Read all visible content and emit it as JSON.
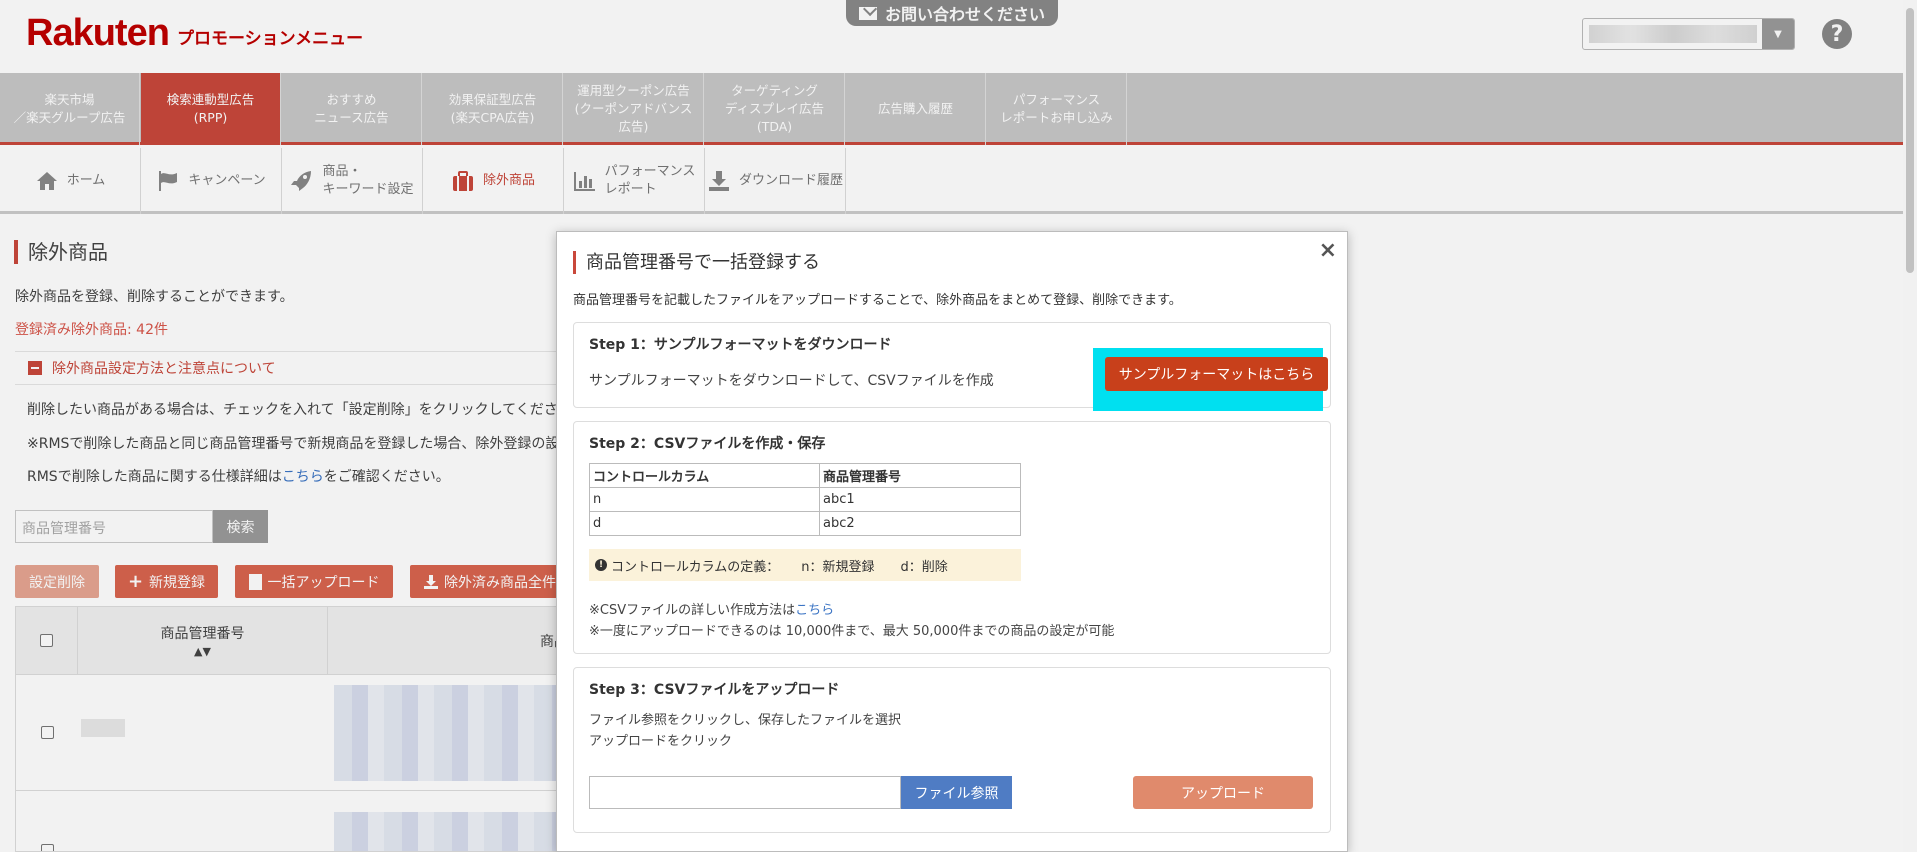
{
  "header": {
    "logo": "Rakuten",
    "logo_sub": "プロモーションメニュー",
    "contact": "お問い合わせください",
    "help": "?"
  },
  "main_nav": [
    {
      "label": "楽天市場\n／楽天グループ広告"
    },
    {
      "label": "検索連動型広告\n(RPP)"
    },
    {
      "label": "おすすめ\nニュース広告"
    },
    {
      "label": "効果保証型広告\n(楽天CPA広告)"
    },
    {
      "label": "運用型クーポン広告\n(クーポンアドバンス\n広告)"
    },
    {
      "label": "ターゲティング\nディスプレイ広告\n(TDA)"
    },
    {
      "label": "広告購入履歴"
    },
    {
      "label": "パフォーマンス\nレポートお申し込み"
    }
  ],
  "sub_nav": [
    {
      "label": "ホーム"
    },
    {
      "label": "キャンペーン"
    },
    {
      "label": "商品・\nキーワード設定"
    },
    {
      "label": "除外商品"
    },
    {
      "label": "パフォーマンス\nレポート"
    },
    {
      "label": "ダウンロード履歴"
    }
  ],
  "page": {
    "title": "除外商品",
    "description": "除外商品を登録、削除することができます。",
    "registered_count": "登録済み除外商品: 42件",
    "notes_header": "除外商品設定方法と注意点について",
    "note1": "削除したい商品がある場合は、チェックを入れて「設定削除」をクリックしてくださ",
    "note2": "※RMSで削除した商品と同じ商品管理番号で新規商品を登録した場合、除外登録の設",
    "note3_pre": "RMSで削除した商品に関する仕様詳細は",
    "note3_link": "こちら",
    "note3_post": "をご確認ください。",
    "search_placeholder": "商品管理番号",
    "search_button": "検索",
    "btn_delete": "設定削除",
    "btn_new": "新規登録",
    "btn_bulk": "一括アップロード",
    "btn_export": "除外済み商品全件",
    "col_id": "商品管理番号",
    "col_name": "商品",
    "sort_arrows": "▲▼"
  },
  "modal": {
    "title": "商品管理番号で一括登録する",
    "close": "×",
    "description": "商品管理番号を記載したファイルをアップロードすることで、除外商品をまとめて登録、削除できます。",
    "step1": {
      "heading": "Step 1：サンプルフォーマットをダウンロード",
      "text": "サンプルフォーマットをダウンロードして、CSVファイルを作成",
      "button": "サンプルフォーマットはこちら"
    },
    "step2": {
      "heading": "Step 2：CSVファイルを作成・保存",
      "table": {
        "headers": [
          "コントロールカラム",
          "商品管理番号"
        ],
        "rows": [
          [
            "n",
            "abc1"
          ],
          [
            "d",
            "abc2"
          ]
        ]
      },
      "info_label": "コントロールカラムの定義：",
      "info_n": "n：新規登録",
      "info_d": "d：削除",
      "detail_pre": "※CSVファイルの詳しい作成方法は",
      "detail_link": "こちら",
      "limit": "※一度にアップロードできるのは 10,000件まで、最大 50,000件までの商品の設定が可能"
    },
    "step3": {
      "heading": "Step 3：CSVファイルをアップロード",
      "line1": "ファイル参照をクリックし、保存したファイルを選択",
      "line2": "アップロードをクリック",
      "browse_button": "ファイル参照",
      "upload_button": "アップロード"
    }
  },
  "colors": {
    "brand": "#bf0000",
    "accent": "#c9483b",
    "highlight": "#00e0f0"
  }
}
